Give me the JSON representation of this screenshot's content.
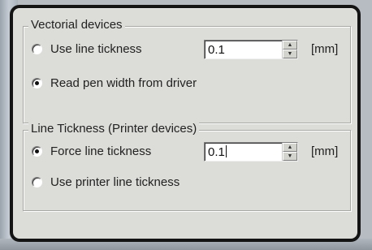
{
  "vectorial": {
    "legend": "Vectorial devices",
    "use_line_thickness_label": "Use line tickness",
    "line_thickness_value": "0.1",
    "unit": "[mm]",
    "read_pen_width_label": "Read pen width from driver"
  },
  "printer": {
    "legend": "Line Tickness (Printer devices)",
    "force_line_thickness_label": "Force line tickness",
    "line_thickness_value": "0.1",
    "unit": "[mm]",
    "use_printer_thickness_label": "Use printer line tickness"
  },
  "icons": {
    "spin_up": "▲",
    "spin_down": "▼"
  }
}
